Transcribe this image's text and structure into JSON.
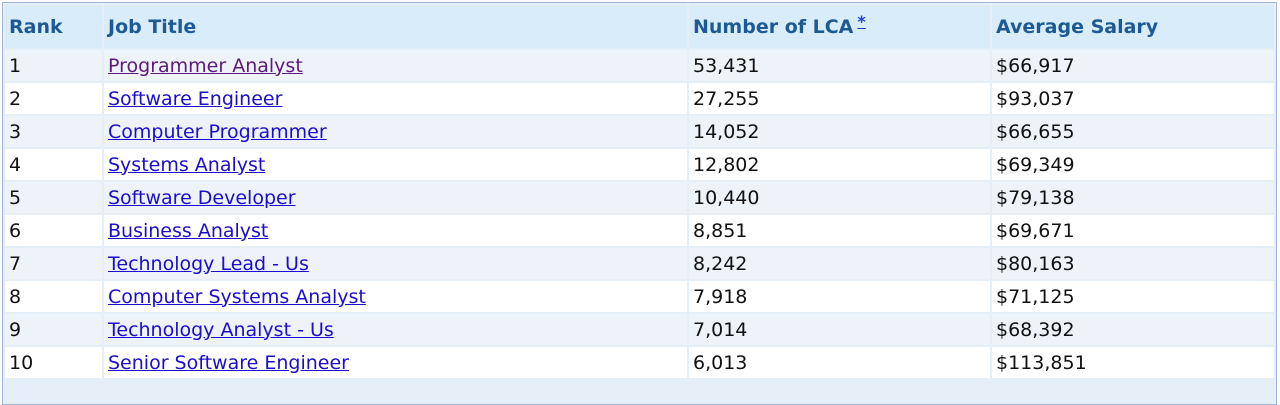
{
  "table": {
    "headers": {
      "rank": "Rank",
      "job_title": "Job Title",
      "lca": "Number of LCA",
      "lca_footnote": "*",
      "salary": "Average Salary"
    },
    "rows": [
      {
        "rank": "1",
        "title": "Programmer Analyst",
        "lca": "53,431",
        "salary": "$66,917",
        "visited": true
      },
      {
        "rank": "2",
        "title": "Software Engineer",
        "lca": "27,255",
        "salary": "$93,037",
        "visited": false
      },
      {
        "rank": "3",
        "title": "Computer Programmer",
        "lca": "14,052",
        "salary": "$66,655",
        "visited": false
      },
      {
        "rank": "4",
        "title": "Systems Analyst",
        "lca": "12,802",
        "salary": "$69,349",
        "visited": false
      },
      {
        "rank": "5",
        "title": "Software Developer",
        "lca": "10,440",
        "salary": "$79,138",
        "visited": false
      },
      {
        "rank": "6",
        "title": "Business Analyst",
        "lca": "8,851",
        "salary": "$69,671",
        "visited": false
      },
      {
        "rank": "7",
        "title": "Technology Lead - Us",
        "lca": "8,242",
        "salary": "$80,163",
        "visited": false
      },
      {
        "rank": "8",
        "title": "Computer Systems Analyst",
        "lca": "7,918",
        "salary": "$71,125",
        "visited": false
      },
      {
        "rank": "9",
        "title": "Technology Analyst - Us",
        "lca": "7,014",
        "salary": "$68,392",
        "visited": false
      },
      {
        "rank": "10",
        "title": "Senior Software Engineer",
        "lca": "6,013",
        "salary": "$113,851",
        "visited": false
      }
    ]
  },
  "colors": {
    "header_bg": "#d9ecfa",
    "header_text": "#1d5a93",
    "link": "#1a0dcc",
    "visited_link": "#5c1a7a",
    "odd_row_bg": "#eef3fa",
    "even_row_bg": "#ffffff"
  }
}
